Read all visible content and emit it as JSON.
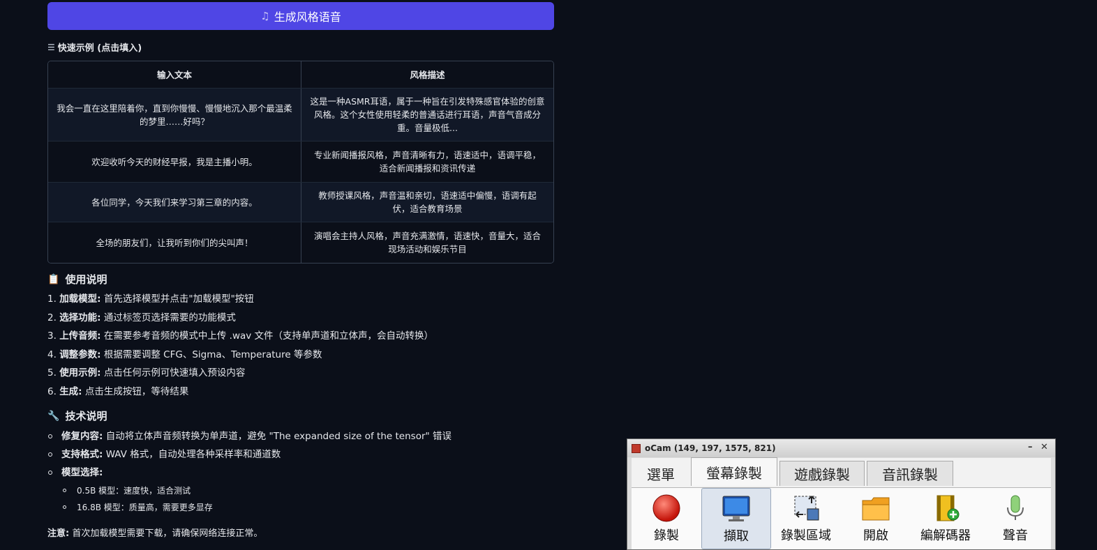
{
  "generate_button": {
    "icon": "music-note-icon",
    "label": "生成风格语音"
  },
  "examples": {
    "title": "快速示例 (点击填入)",
    "headers": [
      "输入文本",
      "风格描述"
    ],
    "rows": [
      [
        "我会一直在这里陪着你，直到你慢慢、慢慢地沉入那个最温柔的梦里……好吗？",
        "这是一种ASMR耳语，属于一种旨在引发特殊感官体验的创意风格。这个女性使用轻柔的普通话进行耳语，声音气音成分重。音量极低..."
      ],
      [
        "欢迎收听今天的财经早报，我是主播小明。",
        "专业新闻播报风格，声音清晰有力，语速适中，语调平稳，适合新闻播报和资讯传递"
      ],
      [
        "各位同学，今天我们来学习第三章的内容。",
        "教师授课风格，声音温和亲切，语速适中偏慢，语调有起伏，适合教育场景"
      ],
      [
        "全场的朋友们，让我听到你们的尖叫声！",
        "演唱会主持人风格，声音充满激情，语速快，音量大，适合现场活动和娱乐节目"
      ]
    ]
  },
  "usage": {
    "title": "使用说明",
    "steps": [
      {
        "num": "1.",
        "bold": "加载模型:",
        "text": " 首先选择模型并点击\"加载模型\"按钮"
      },
      {
        "num": "2.",
        "bold": "选择功能:",
        "text": " 通过标签页选择需要的功能模式"
      },
      {
        "num": "3.",
        "bold": "上传音频:",
        "text": " 在需要参考音频的模式中上传 .wav 文件（支持单声道和立体声，会自动转换）"
      },
      {
        "num": "4.",
        "bold": "调整参数:",
        "text": " 根据需要调整 CFG、Sigma、Temperature 等参数"
      },
      {
        "num": "5.",
        "bold": "使用示例:",
        "text": " 点击任何示例可快速填入预设内容"
      },
      {
        "num": "6.",
        "bold": "生成:",
        "text": " 点击生成按钮，等待结果"
      }
    ]
  },
  "tech": {
    "title": "技术说明",
    "items": [
      {
        "bold": "修复内容:",
        "text": " 自动将立体声音频转换为单声道，避免 \"The expanded size of the tensor\" 错误"
      },
      {
        "bold": "支持格式:",
        "text": " WAV 格式，自动处理各种采样率和通道数"
      },
      {
        "bold": "模型选择:",
        "text": ""
      }
    ],
    "subitems": [
      "0.5B 模型：速度快，适合测试",
      "16.8B 模型：质量高，需要更多显存"
    ],
    "note_bold": "注意:",
    "note_text": " 首次加载模型需要下载，请确保网络连接正常。"
  },
  "ocam": {
    "title": "oCam (149, 197, 1575, 821)",
    "minimize": "–",
    "close": "✕",
    "tabs": [
      "選單",
      "螢幕錄製",
      "遊戲錄製",
      "音訊錄製"
    ],
    "tools": [
      "錄製",
      "擷取",
      "錄製區域",
      "開啟",
      "編解碼器",
      "聲音"
    ]
  }
}
